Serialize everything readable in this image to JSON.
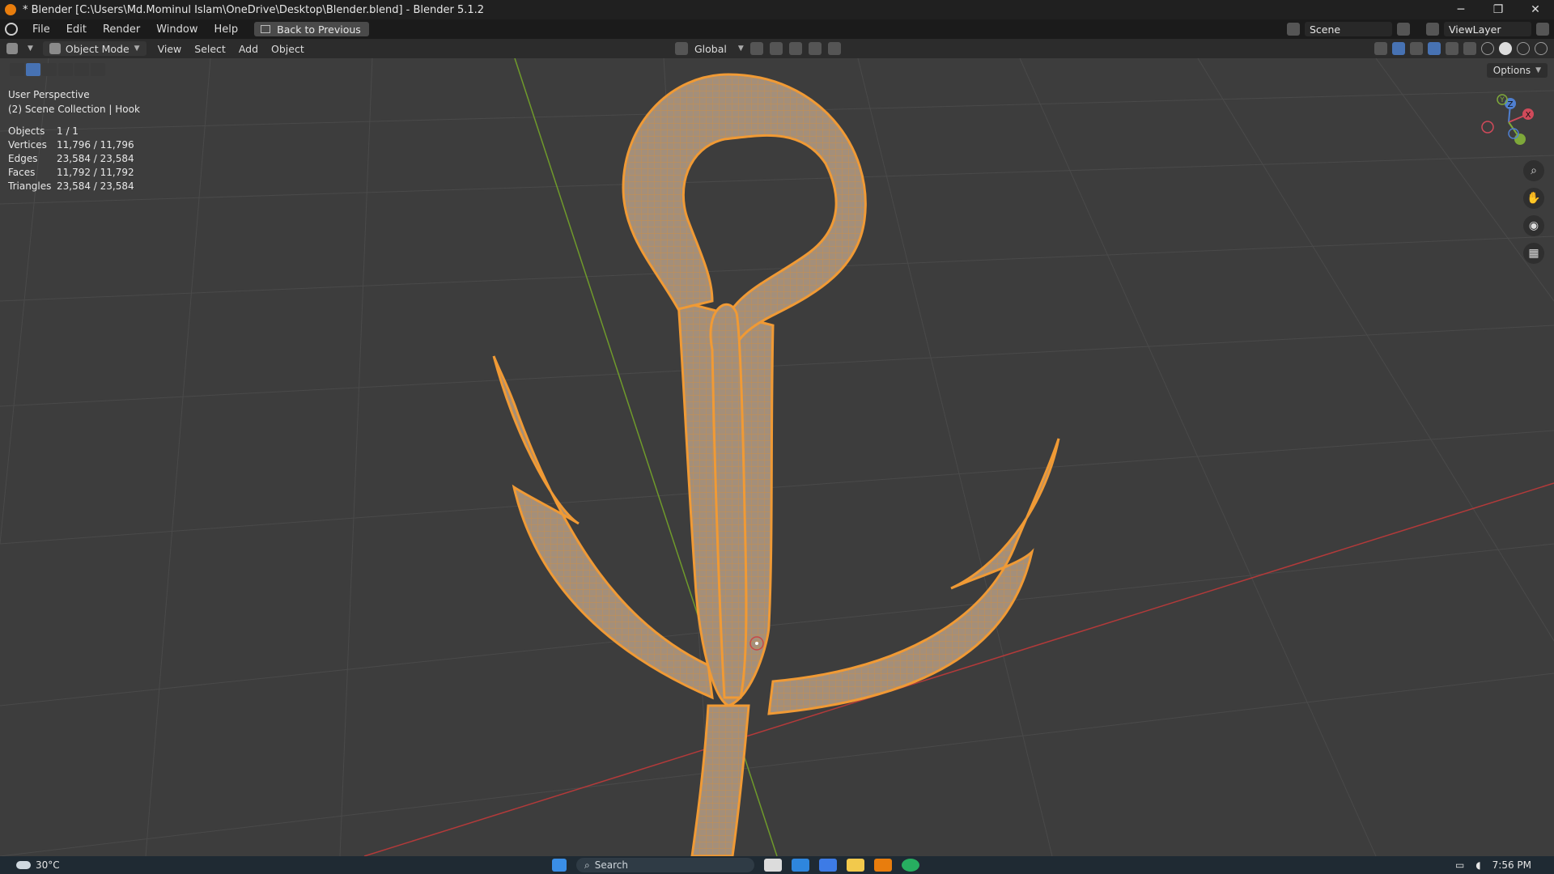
{
  "window": {
    "title": "* Blender [C:\\Users\\Md.Mominul Islam\\OneDrive\\Desktop\\Blender.blend] - Blender 5.1.2",
    "controls": [
      "─",
      "❐",
      "✕"
    ]
  },
  "menubar": {
    "items": [
      "File",
      "Edit",
      "Render",
      "Window",
      "Help"
    ],
    "back_button": "Back to Previous",
    "scene": "Scene",
    "view_layer": "ViewLayer"
  },
  "header": {
    "mode": "Object Mode",
    "menus": [
      "View",
      "Select",
      "Add",
      "Object"
    ],
    "orientation": "Global"
  },
  "toolbar": {
    "options": "Options"
  },
  "viewport": {
    "perspective": "User Perspective",
    "collection": "(2) Scene Collection | Hook",
    "stats": [
      {
        "label": "Objects",
        "value": "1 / 1"
      },
      {
        "label": "Vertices",
        "value": "11,796 / 11,796"
      },
      {
        "label": "Edges",
        "value": "23,584 / 23,584"
      },
      {
        "label": "Faces",
        "value": "11,792 / 11,792"
      },
      {
        "label": "Triangles",
        "value": "23,584 / 23,584"
      }
    ],
    "gizmo": {
      "x": "X",
      "y": "Y",
      "z": "Z"
    }
  },
  "colors": {
    "selection": "#f09a35",
    "mesh": "#a08c78",
    "grid": "#4a4a4a",
    "x_axis": "#b33a3a",
    "y_axis": "#6f9a2b"
  },
  "taskbar": {
    "temperature": "30°C",
    "search_placeholder": "Search",
    "time": "7:56 PM"
  }
}
